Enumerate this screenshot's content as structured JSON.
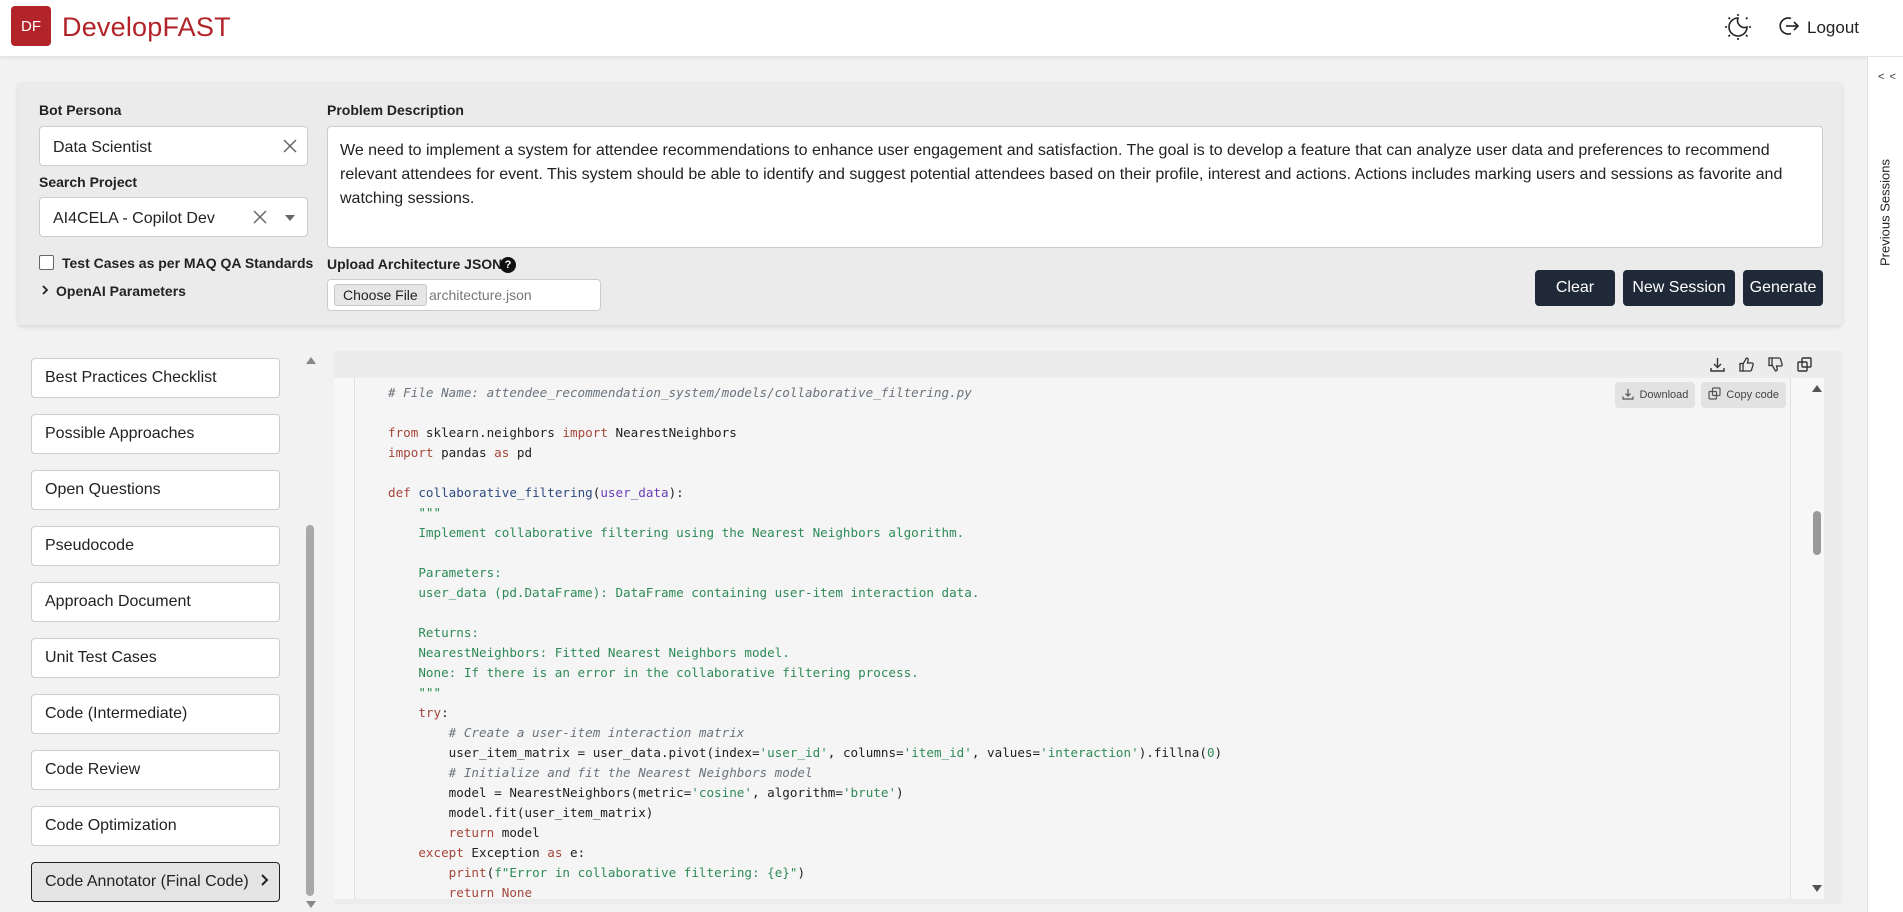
{
  "header": {
    "logo_initials": "DF",
    "app_title": "DevelopFAST",
    "theme_icon": "moon-sun-icon",
    "logout_label": "Logout"
  },
  "rail": {
    "collapse_label": "< <",
    "label": "Previous Sessions"
  },
  "form": {
    "bot_persona_label": "Bot Persona",
    "bot_persona_value": "Data Scientist",
    "search_project_label": "Search Project",
    "search_project_value": "AI4CELA - Copilot Dev",
    "test_cases_label": "Test Cases as per MAQ QA Standards",
    "test_cases_checked": false,
    "openai_label": "OpenAI Parameters",
    "problem_label": "Problem Description",
    "problem_text": "We need to implement a system for attendee recommendations to enhance user engagement and satisfaction. The goal is to develop a feature that can analyze user data and preferences to recommend relevant attendees for event. This system should be able to identify and suggest potential attendees based on their profile, interest and actions. Actions includes marking users and sessions as favorite and watching sessions.",
    "upload_label": "Upload Architecture JSON",
    "help_glyph": "?",
    "choose_file_label": "Choose File",
    "file_name": "architecture.json",
    "clear_label": "Clear",
    "new_session_label": "New Session",
    "generate_label": "Generate"
  },
  "nav": {
    "items": [
      {
        "label": "Best Practices Checklist"
      },
      {
        "label": "Possible Approaches"
      },
      {
        "label": "Open Questions"
      },
      {
        "label": "Pseudocode"
      },
      {
        "label": "Approach Document"
      },
      {
        "label": "Unit Test Cases"
      },
      {
        "label": "Code (Intermediate)"
      },
      {
        "label": "Code Review"
      },
      {
        "label": "Code Optimization"
      },
      {
        "label": "Code Annotator (Final Code)",
        "active": true
      }
    ]
  },
  "output": {
    "icons": [
      "download-icon",
      "thumbs-up-icon",
      "thumbs-down-icon",
      "copy-icon"
    ],
    "download_label": "Download",
    "copy_label": "Copy code",
    "language": "python",
    "code_lines": [
      "# File Name: attendee_recommendation_system/models/collaborative_filtering.py",
      "",
      "from sklearn.neighbors import NearestNeighbors",
      "import pandas as pd",
      "",
      "def collaborative_filtering(user_data):",
      "    \"\"\"",
      "    Implement collaborative filtering using the Nearest Neighbors algorithm.",
      "",
      "    Parameters:",
      "    user_data (pd.DataFrame): DataFrame containing user-item interaction data.",
      "",
      "    Returns:",
      "    NearestNeighbors: Fitted Nearest Neighbors model.",
      "    None: If there is an error in the collaborative filtering process.",
      "    \"\"\"",
      "    try:",
      "        # Create a user-item interaction matrix",
      "        user_item_matrix = user_data.pivot(index='user_id', columns='item_id', values='interaction').fillna(0)",
      "        # Initialize and fit the Nearest Neighbors model",
      "        model = NearestNeighbors(metric='cosine', algorithm='brute')",
      "        model.fit(user_item_matrix)",
      "        return model",
      "    except Exception as e:",
      "        print(f\"Error in collaborative filtering: {e}\")",
      "        return None"
    ]
  },
  "colors": {
    "brand": "#b3242a",
    "dark_button": "#1f2937",
    "comment": "#6a737d",
    "keyword": "#a5463b",
    "docstring": "#2e8b57"
  }
}
